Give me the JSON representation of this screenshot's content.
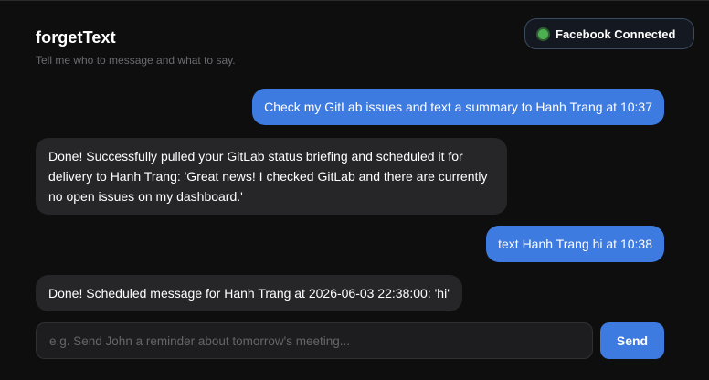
{
  "app": {
    "title": "forgetText",
    "subtitle": "Tell me who to message and what to say."
  },
  "status": {
    "label": "Facebook Connected",
    "color": "#4caf50"
  },
  "messages": [
    {
      "role": "user",
      "text": "Check my GitLab issues and text a summary to Hanh Trang at 10:37"
    },
    {
      "role": "bot",
      "text": "Done! Successfully pulled your GitLab status briefing and scheduled it for delivery to Hanh Trang: 'Great news! I checked GitLab and there are currently no open issues on my dashboard.'"
    },
    {
      "role": "user",
      "text": "text Hanh Trang hi at 10:38"
    },
    {
      "role": "bot",
      "text": "Done! Scheduled message for Hanh Trang at 2026-06-03 22:38:00: 'hi'"
    }
  ],
  "composer": {
    "placeholder": "e.g. Send John a reminder about tomorrow's meeting...",
    "value": "",
    "send_label": "Send"
  },
  "colors": {
    "accent": "#3d7be0",
    "bot_bubble": "#262628",
    "background": "#0e0e0f"
  }
}
